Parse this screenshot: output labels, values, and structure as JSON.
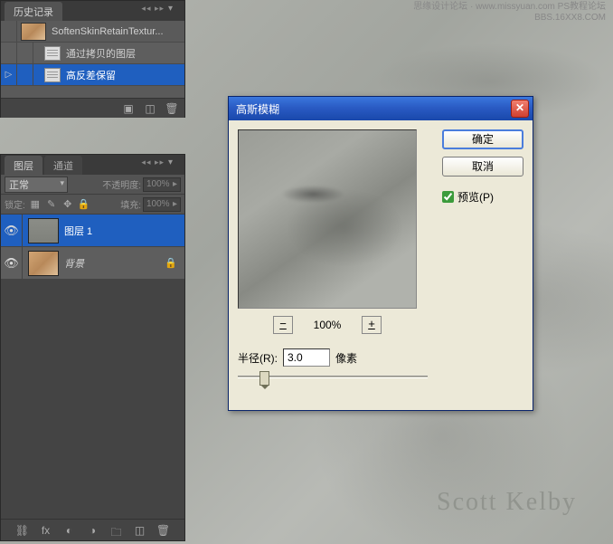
{
  "watermark": {
    "line1": "思缘设计论坛 · www.missyuan.com   PS教程论坛",
    "line2": "BBS.16XX8.COM"
  },
  "signature": "Scott Kelby",
  "history_panel": {
    "tab": "历史记录",
    "snapshot_label": "SoftenSkinRetainTextur...",
    "step1_label": "通过拷贝的图层",
    "step2_label": "高反差保留"
  },
  "layers_panel": {
    "tabs": {
      "layers": "图层",
      "channels": "通道"
    },
    "blend_mode": "正常",
    "opacity_label": "不透明度:",
    "opacity_value": "100%",
    "lock_label": "锁定:",
    "fill_label": "填充:",
    "fill_value": "100%",
    "layer1_name": "图层 1",
    "bg_name": "背景"
  },
  "dialog": {
    "title": "高斯模糊",
    "ok": "确定",
    "cancel": "取消",
    "preview_label": "预览(P)",
    "preview_checked": true,
    "zoom_pct": "100%",
    "radius_label": "半径(R):",
    "radius_value": "3.0",
    "radius_unit": "像素"
  }
}
